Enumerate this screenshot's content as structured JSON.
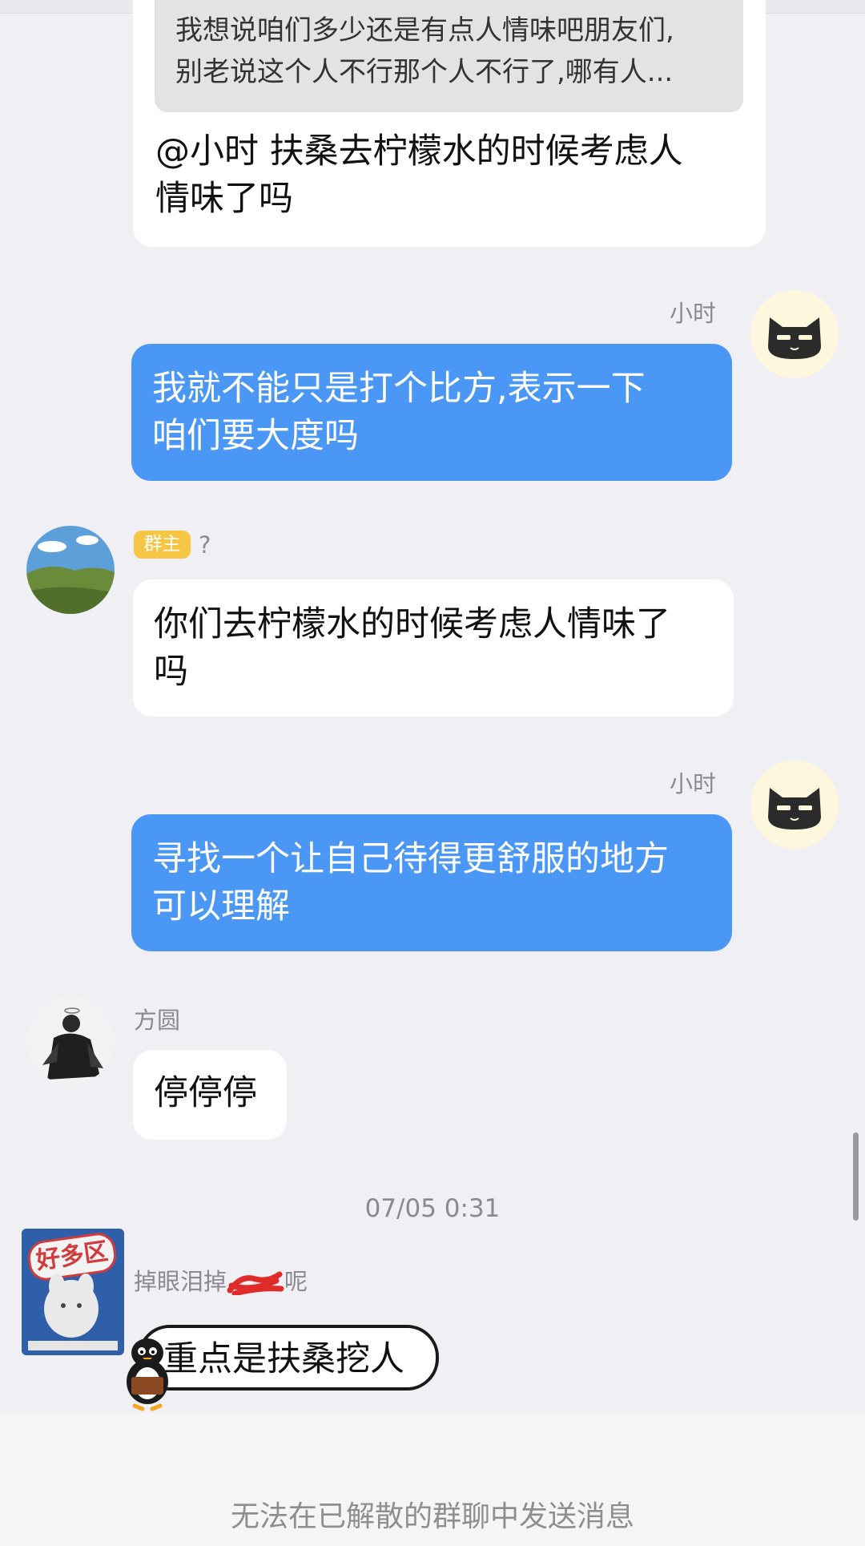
{
  "quote": {
    "line1": "我想说咱们多少还是有点人情味吧朋友们,",
    "line2": "别老说这个人不行那个人不行了,哪有人..."
  },
  "messages": [
    {
      "lines": [
        "@小时 扶桑去柠檬水的时候考虑人",
        "情味了吗"
      ]
    },
    {
      "sender": "小时",
      "lines": [
        "我就不能只是打个比方,表示一下",
        "咱们要大度吗"
      ]
    },
    {
      "badge": "群主",
      "sender": "?",
      "lines": [
        "你们去柠檬水的时候考虑人情味了",
        "吗"
      ]
    },
    {
      "sender": "小时",
      "lines": [
        "寻找一个让自己待得更舒服的地方",
        "可以理解"
      ]
    },
    {
      "sender": "方圆",
      "lines": [
        "停停停"
      ]
    },
    {
      "sender_visible": "掉眼泪掉",
      "sender_tail": "呢",
      "lines": [
        "重点是扶桑挖人"
      ]
    }
  ],
  "timestamp": "07/05 0:31",
  "sticker_avatar_text": "好多区",
  "bottom_notice": "无法在已解散的群聊中发送消息",
  "colors": {
    "background": "#efeff4",
    "outgoing_bubble": "#4a97f5",
    "incoming_bubble": "#ffffff",
    "owner_badge": "#f6c544"
  }
}
